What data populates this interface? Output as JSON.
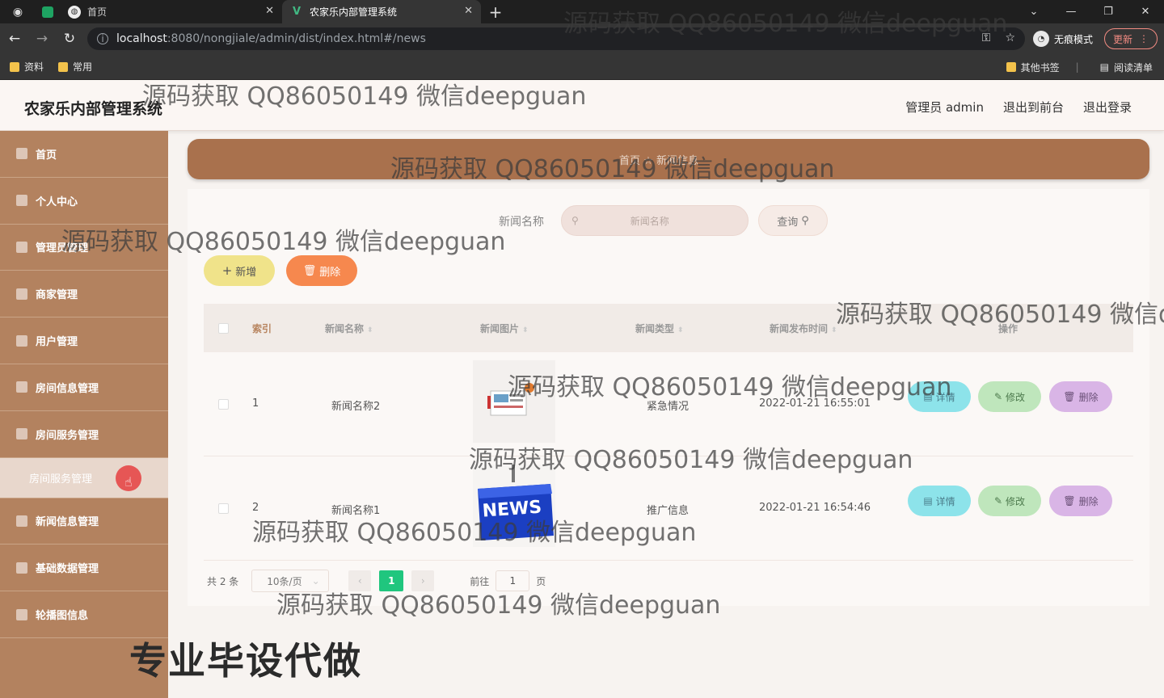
{
  "browser": {
    "tabs": [
      {
        "label": "首页",
        "active": false
      },
      {
        "label": "农家乐内部管理系统",
        "active": true
      }
    ],
    "url_host": "localhost",
    "url_rest": ":8080/nongjiale/admin/dist/index.html#/news",
    "incognito_label": "无痕模式",
    "update_label": "更新",
    "bookmarks": [
      "资料",
      "常用"
    ],
    "other_bookmarks": "其他书签",
    "reading_list": "阅读清单"
  },
  "header": {
    "title": "农家乐内部管理系统",
    "admin_label": "管理员 admin",
    "back_front": "退出到前台",
    "logout": "退出登录"
  },
  "sidebar": {
    "items": [
      {
        "label": "首页"
      },
      {
        "label": "个人中心"
      },
      {
        "label": "管理员管理"
      },
      {
        "label": "商家管理"
      },
      {
        "label": "用户管理"
      },
      {
        "label": "房间信息管理"
      },
      {
        "label": "房间服务管理"
      },
      {
        "label": "房间服务管理",
        "sub": true
      },
      {
        "label": "新闻信息管理"
      },
      {
        "label": "基础数据管理"
      },
      {
        "label": "轮播图信息"
      }
    ],
    "footer_text": "专业毕设代做"
  },
  "breadcrumb": {
    "home": "首页",
    "current": "新闻信息"
  },
  "search": {
    "label": "新闻名称",
    "placeholder": "新闻名称",
    "query_label": "查询"
  },
  "actions": {
    "add_label": "新增",
    "delete_label": "删除"
  },
  "table": {
    "headers": {
      "index": "索引",
      "name": "新闻名称",
      "image": "新闻图片",
      "type": "新闻类型",
      "time": "新闻发布时间",
      "ops": "操作"
    },
    "rows": [
      {
        "index": "1",
        "name": "新闻名称2",
        "type": "紧急情况",
        "time": "2022-01-21 16:55:01"
      },
      {
        "index": "2",
        "name": "新闻名称1",
        "type": "推广信息",
        "time": "2022-01-21 16:54:46"
      }
    ],
    "op_detail": "详情",
    "op_edit": "修改",
    "op_delete": "删除"
  },
  "pagination": {
    "total": "共 2 条",
    "page_size": "10条/页",
    "current_page": "1",
    "goto_label": "前往",
    "goto_value": "1",
    "page_unit": "页"
  },
  "watermark": "源码获取 QQ86050149 微信deepguan",
  "watermark_cut": "源码获取 QQ86050149 微信d",
  "news_image_text": "NEWS"
}
